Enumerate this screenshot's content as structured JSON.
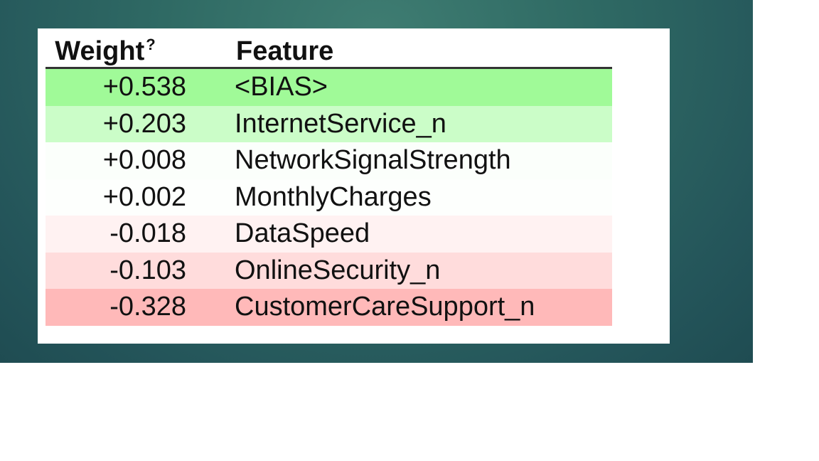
{
  "table": {
    "headers": {
      "weight": "Weight",
      "weight_help": "?",
      "feature": "Feature"
    },
    "rows": [
      {
        "weight": "+0.538",
        "feature": "<BIAS>",
        "color": "#a0fa98"
      },
      {
        "weight": "+0.203",
        "feature": "InternetService_n",
        "color": "#cbfdc8"
      },
      {
        "weight": "+0.008",
        "feature": "NetworkSignalStrength",
        "color": "#fbfffb"
      },
      {
        "weight": "+0.002",
        "feature": "MonthlyCharges",
        "color": "#fdfffd"
      },
      {
        "weight": "-0.018",
        "feature": "DataSpeed",
        "color": "#fff2f2"
      },
      {
        "weight": "-0.103",
        "feature": "OnlineSecurity_n",
        "color": "#ffdcdc"
      },
      {
        "weight": "-0.328",
        "feature": "CustomerCareSupport_n",
        "color": "#ffb9b9"
      }
    ]
  }
}
